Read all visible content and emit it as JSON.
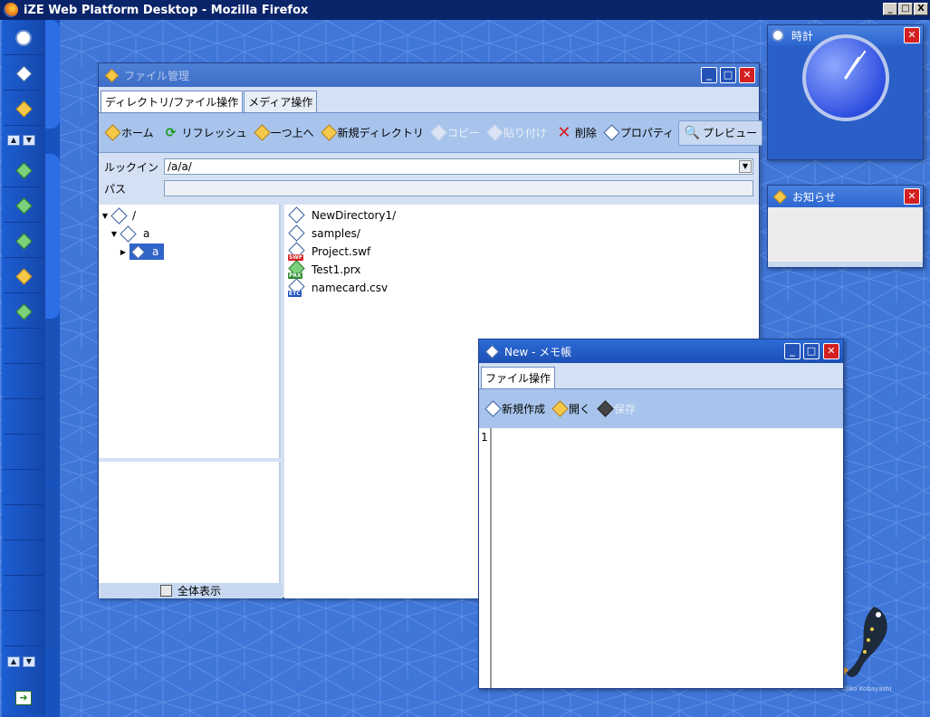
{
  "browser": {
    "title": "iZE Web Platform Desktop - Mozilla Firefox",
    "controls": [
      "_",
      "□",
      "X"
    ]
  },
  "sidebar": {
    "icons": [
      "clock-icon",
      "mail-icon",
      "notice-icon",
      "download-icon",
      "download-icon",
      "download-icon",
      "folder-icon",
      "memo-icon"
    ],
    "exit_icon": "exit-icon"
  },
  "file_manager": {
    "title": "ファイル管理",
    "tabs": [
      "ディレクトリ/ファイル操作",
      "メディア操作"
    ],
    "toolbar": {
      "home": "ホーム",
      "refresh": "リフレッシュ",
      "up": "一つ上へ",
      "new_dir": "新規ディレクトリ",
      "copy": "コピー",
      "paste": "貼り付け",
      "delete": "削除",
      "properties": "プロパティ",
      "preview": "プレビュー"
    },
    "lookin_label": "ルックイン",
    "lookin_value": "/a/a/",
    "path_label": "パス",
    "path_value": "",
    "tree": [
      {
        "label": "/"
      },
      {
        "label": "a"
      },
      {
        "label": "a"
      }
    ],
    "files": [
      {
        "name": "NewDirectory1/"
      },
      {
        "name": "samples/"
      },
      {
        "name": "Project.swf",
        "badge": "SWF"
      },
      {
        "name": "Test1.prx",
        "badge": "PRX"
      },
      {
        "name": "namecard.csv",
        "badge": "ETC"
      }
    ],
    "show_all": "全体表示"
  },
  "clock_widget": {
    "title": "時計",
    "time": {
      "hour": 1,
      "minute": 6
    }
  },
  "notice_widget": {
    "title": "お知らせ"
  },
  "memo": {
    "title": "New - メモ帳",
    "tab": "ファイル操作",
    "toolbar": {
      "new": "新規作成",
      "open": "開く",
      "save": "保存"
    },
    "line_number": "1"
  },
  "watermark": "Kiiko Kobayashi",
  "colors": {
    "desktop": "#3f76d8",
    "window_title": "#1c4fb4",
    "close": "#d42020"
  }
}
